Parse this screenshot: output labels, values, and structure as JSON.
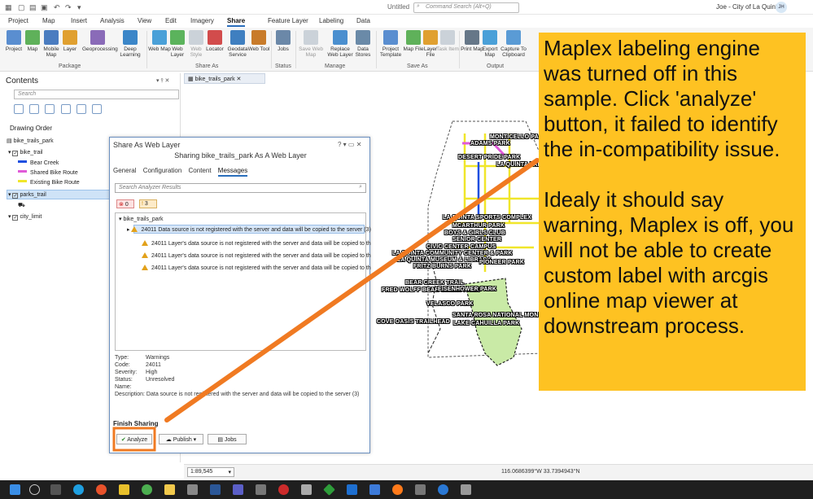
{
  "window": {
    "doc_title": "Untitled",
    "command_search_placeholder": "Command Search (Alt+Q)",
    "user_name": "Joe - City of La Quinta",
    "user_initials": "JH"
  },
  "tabs": [
    "Project",
    "Map",
    "Insert",
    "Analysis",
    "View",
    "Edit",
    "Imagery",
    "Share",
    "Feature Layer",
    "Labeling",
    "Data"
  ],
  "ribbon": {
    "package_buttons": [
      "Project",
      "Map",
      "Mobile Map",
      "Layer",
      "Geoprocessing",
      "Deep Learning"
    ],
    "share_as_buttons": [
      "Web Map",
      "Web Layer",
      "Web Style",
      "Locator",
      "Geodata Service",
      "Web Tool"
    ],
    "status_buttons": [
      "Jobs"
    ],
    "manage_buttons": [
      "Save Web Map",
      "Replace Web Layer",
      "Data Stores"
    ],
    "save_as_buttons": [
      "Project Template",
      "Map File",
      "Layer File",
      "Task Item"
    ],
    "output_buttons": [
      "Print Map",
      "Export Map",
      "Capture To Clipboard"
    ],
    "groups": [
      "Package",
      "Share As",
      "Status",
      "Manage",
      "Save As",
      "Output"
    ]
  },
  "contents": {
    "title": "Contents",
    "search_placeholder": "Search",
    "drawing_order": "Drawing Order",
    "items": {
      "map": "bike_trails_park",
      "bike_trail": "bike_trail",
      "bear_creek": "Bear Creek",
      "shared_bike_route": "Shared Bike Route",
      "existing_bike_route": "Existing Bike Route",
      "parks_trail": "parks_trail",
      "city_limit": "city_limit"
    },
    "colors": {
      "bear_creek": "#1f4fe0",
      "shared_bike_route": "#e05ad8",
      "existing_bike_route": "#f0e62a"
    }
  },
  "map_tab": "bike_trails_park",
  "map_labels": [
    "MONTICELLO PA",
    "ADAMS PARK",
    "DESERT PRIDE PARK",
    "LA QUINTA PARK",
    "LA QUINTA SPORTS COMPLEX",
    "MCARTHUR PARK",
    "BOYS & GIRLS CLUB",
    "SENIOR CENTER",
    "CIVIC CENTER CAMPUS",
    "LA QUINTA COMMUNITY CENTER & PARK",
    "LA QUINTA MUSEUM & LIBRARY",
    "FRITZ BURNS PARK",
    "PIONEER PARK",
    "BEAR CREEK TRAIL",
    "FRED WOLFF BEAR CREEK PARK",
    "EISENHOWER PARK",
    "VELASCO PARK",
    "SANTA ROSA NATIONAL MON",
    "COVE OASIS TRAILHEAD",
    "LAKE CAHUILLA PARK"
  ],
  "dialog": {
    "title": "Share As Web Layer",
    "subtitle": "Sharing bike_trails_park As A Web Layer",
    "tabs": [
      "General",
      "Configuration",
      "Content",
      "Messages"
    ],
    "search_placeholder": "Search Analyzer Results",
    "error_count": "0",
    "warning_count": "3",
    "tree_root": "bike_trails_park",
    "messages": [
      "24011 Data source is not registered with the server and data will be copied to the server (3)",
      "24011 Layer's data source is not registered with the server and data will be copied to th",
      "24011 Layer's data source is not registered with the server and data will be copied to th",
      "24011 Layer's data source is not registered with the server and data will be copied to th"
    ],
    "details": {
      "type_k": "Type:",
      "type_v": "Warnings",
      "code_k": "Code:",
      "code_v": "24011",
      "severity_k": "Severity:",
      "severity_v": "High",
      "status_k": "Status:",
      "status_v": "Unresolved",
      "name_k": "Name:",
      "description_k": "Description:",
      "description_v": "Data source is not registered with the server and data will be copied to the server (3)"
    },
    "finish_sharing": "Finish Sharing",
    "analyze": "Analyze",
    "publish": "Publish",
    "jobs": "Jobs"
  },
  "status": {
    "scale": "1:89,545",
    "coords": "116.0686399°W 33.7394943°N"
  },
  "callout": {
    "para1": "Maplex labeling engine was turned off in this sample. Click 'analyze' button, it failed to identify the in-compatibility issue.",
    "para2": "Idealy it should say warning, Maplex is off, you will not be able to create custom label with arcgis online map viewer at downstream process.",
    "color": "#fec222"
  },
  "annotation_color": "#f07a22"
}
